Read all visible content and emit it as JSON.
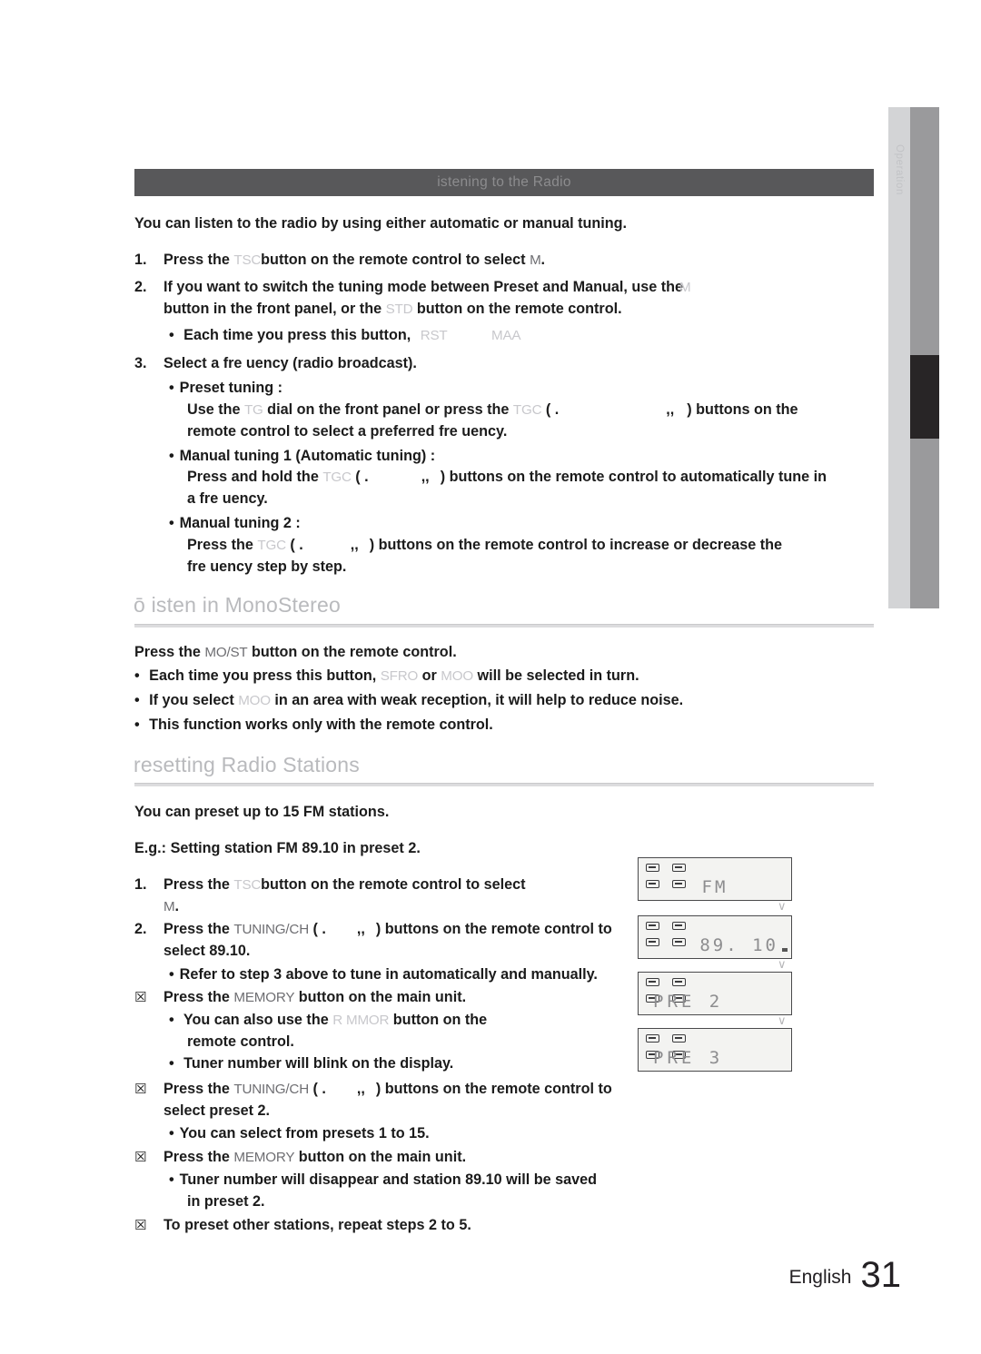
{
  "side_tab": {
    "label": "Operation"
  },
  "section": {
    "title": "istening to the Radio",
    "intro": "You can listen to the radio by using either automatic or manual tuning.",
    "steps": [
      {
        "num": "1.",
        "pre": "Press the ",
        "ghost1": "TSC",
        "mid": "button on the remote control to select ",
        "ghost2": "M",
        "post": "."
      },
      {
        "num": "2.",
        "line1_pre": "If you want to switch the tuning mode between Preset and Manual, use the",
        "line1_ghost": "M",
        "line2_pre": "button in the front panel, or the ",
        "line2_ghost": "STD",
        "line2_post": " button on the remote control.",
        "bullet": "Each time you press this button,",
        "bullet_ghost1": "RST",
        "bullet_ghost2": "MAA"
      },
      {
        "num": "3.",
        "text": "Select a fre uency (radio broadcast)."
      }
    ],
    "preset_tuning": {
      "label": "Preset tuning :",
      "line1_a": "Use the ",
      "line1_ghost1": "TG",
      "line1_b": " dial on the front panel or press the ",
      "line1_ghost2": "TGC",
      "line1_c": " ( .",
      "line1_d": ",,",
      "line1_e": ") buttons on the",
      "line2": "remote control to select a preferred fre uency."
    },
    "manual_tuning_1": {
      "label": "Manual tuning 1 (Automatic tuning) :",
      "line1_a": "Press and hold the ",
      "line1_ghost": "TGC",
      "line1_b": " ( .",
      "line1_c": ",,",
      "line1_d": ") buttons on the remote control to automatically tune in",
      "line2": "a fre uency."
    },
    "manual_tuning_2": {
      "label": "Manual tuning 2 :",
      "line1_a": "Press the ",
      "line1_ghost": "TGC",
      "line1_b": " ( .",
      "line1_c": ",,",
      "line1_d": ") buttons on the remote control to increase or decrease the",
      "line2": "fre uency step by step."
    }
  },
  "mono_stereo": {
    "heading": "ō isten in MonoStereo",
    "line1_a": "Press the ",
    "line1_ghost": "MO/ST",
    "line1_b": " button on the remote control.",
    "bullets": [
      {
        "a": "Each time you press this button, ",
        "g1": "SFRO",
        "b": " or ",
        "g2": "MOO",
        "c": " will be selected in turn."
      },
      {
        "a": "If you select ",
        "g1": "MOO",
        "b": " in an area with weak reception, it will help to reduce noise.",
        "g2": "",
        "c": ""
      },
      {
        "a": "This function works only with the remote control.",
        "g1": "",
        "b": "",
        "g2": "",
        "c": ""
      }
    ]
  },
  "presetting": {
    "heading": "resetting Radio Stations",
    "intro": "You can preset up to 15 FM stations.",
    "example": "E.g.: Setting station FM 89.10 in preset 2.",
    "steps": [
      {
        "num": "1.",
        "a": "Press the ",
        "g1": "TSC",
        "b": "button on the remote control to select",
        "line2_ghost": "M",
        "line2_post": "."
      },
      {
        "num": "2.",
        "a": "Press the ",
        "g1": "TUNING/CH",
        "b": " ( .",
        "c": ",,",
        "d": ") buttons on the remote control to",
        "line2": "select 89.10.",
        "bullet": "Refer to step 3 above to tune in automatically and manually."
      },
      {
        "num": "☒",
        "a": "Press the ",
        "g1": "MEMORY",
        "b": " button on the main unit.",
        "bullets": [
          {
            "a": "You can also use the ",
            "g": "R MMOR",
            "b": " button on the",
            "line2": "remote control."
          },
          {
            "a": "Tuner number will blink on the display.",
            "g": "",
            "b": "",
            "line2": ""
          }
        ]
      },
      {
        "num": "☒",
        "a": "Press the ",
        "g1": "TUNING/CH",
        "b": " ( .",
        "c": ",,",
        "d": ") buttons on the remote control to",
        "line2": "select preset 2.",
        "bullet": "You can select from presets 1 to 15."
      },
      {
        "num": "☒",
        "a": "Press the ",
        "g1": "MEMORY",
        "b": " button on the main unit.",
        "bullet_l1": "Tuner number will disappear and station 89.10 will be saved",
        "bullet_l2": "in preset 2."
      },
      {
        "num": "☒",
        "a": "To preset other stations, repeat steps 2 to 5."
      }
    ],
    "displays": [
      {
        "text": "FM",
        "align": "center"
      },
      {
        "text": "89. 10",
        "align": "right"
      },
      {
        "text": "PRE  2",
        "align": "left"
      },
      {
        "text": "PRE  3",
        "align": "left"
      }
    ]
  },
  "footer": {
    "language": "English",
    "page": "31"
  }
}
